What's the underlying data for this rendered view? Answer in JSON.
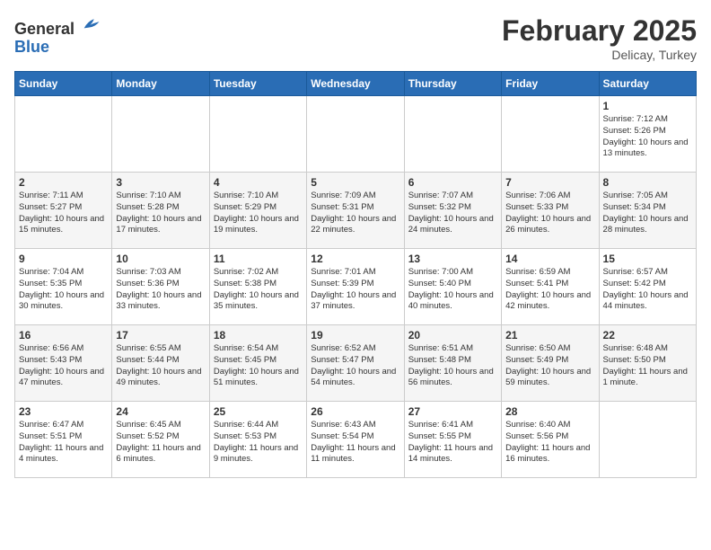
{
  "header": {
    "logo_general": "General",
    "logo_blue": "Blue",
    "month": "February 2025",
    "location": "Delicay, Turkey"
  },
  "weekdays": [
    "Sunday",
    "Monday",
    "Tuesday",
    "Wednesday",
    "Thursday",
    "Friday",
    "Saturday"
  ],
  "weeks": [
    [
      null,
      null,
      null,
      null,
      null,
      null,
      {
        "day": 1,
        "sunrise": "7:12 AM",
        "sunset": "5:26 PM",
        "daylight": "10 hours and 13 minutes."
      }
    ],
    [
      {
        "day": 2,
        "sunrise": "7:11 AM",
        "sunset": "5:27 PM",
        "daylight": "10 hours and 15 minutes."
      },
      {
        "day": 3,
        "sunrise": "7:10 AM",
        "sunset": "5:28 PM",
        "daylight": "10 hours and 17 minutes."
      },
      {
        "day": 4,
        "sunrise": "7:10 AM",
        "sunset": "5:29 PM",
        "daylight": "10 hours and 19 minutes."
      },
      {
        "day": 5,
        "sunrise": "7:09 AM",
        "sunset": "5:31 PM",
        "daylight": "10 hours and 22 minutes."
      },
      {
        "day": 6,
        "sunrise": "7:07 AM",
        "sunset": "5:32 PM",
        "daylight": "10 hours and 24 minutes."
      },
      {
        "day": 7,
        "sunrise": "7:06 AM",
        "sunset": "5:33 PM",
        "daylight": "10 hours and 26 minutes."
      },
      {
        "day": 8,
        "sunrise": "7:05 AM",
        "sunset": "5:34 PM",
        "daylight": "10 hours and 28 minutes."
      }
    ],
    [
      {
        "day": 9,
        "sunrise": "7:04 AM",
        "sunset": "5:35 PM",
        "daylight": "10 hours and 30 minutes."
      },
      {
        "day": 10,
        "sunrise": "7:03 AM",
        "sunset": "5:36 PM",
        "daylight": "10 hours and 33 minutes."
      },
      {
        "day": 11,
        "sunrise": "7:02 AM",
        "sunset": "5:38 PM",
        "daylight": "10 hours and 35 minutes."
      },
      {
        "day": 12,
        "sunrise": "7:01 AM",
        "sunset": "5:39 PM",
        "daylight": "10 hours and 37 minutes."
      },
      {
        "day": 13,
        "sunrise": "7:00 AM",
        "sunset": "5:40 PM",
        "daylight": "10 hours and 40 minutes."
      },
      {
        "day": 14,
        "sunrise": "6:59 AM",
        "sunset": "5:41 PM",
        "daylight": "10 hours and 42 minutes."
      },
      {
        "day": 15,
        "sunrise": "6:57 AM",
        "sunset": "5:42 PM",
        "daylight": "10 hours and 44 minutes."
      }
    ],
    [
      {
        "day": 16,
        "sunrise": "6:56 AM",
        "sunset": "5:43 PM",
        "daylight": "10 hours and 47 minutes."
      },
      {
        "day": 17,
        "sunrise": "6:55 AM",
        "sunset": "5:44 PM",
        "daylight": "10 hours and 49 minutes."
      },
      {
        "day": 18,
        "sunrise": "6:54 AM",
        "sunset": "5:45 PM",
        "daylight": "10 hours and 51 minutes."
      },
      {
        "day": 19,
        "sunrise": "6:52 AM",
        "sunset": "5:47 PM",
        "daylight": "10 hours and 54 minutes."
      },
      {
        "day": 20,
        "sunrise": "6:51 AM",
        "sunset": "5:48 PM",
        "daylight": "10 hours and 56 minutes."
      },
      {
        "day": 21,
        "sunrise": "6:50 AM",
        "sunset": "5:49 PM",
        "daylight": "10 hours and 59 minutes."
      },
      {
        "day": 22,
        "sunrise": "6:48 AM",
        "sunset": "5:50 PM",
        "daylight": "11 hours and 1 minute."
      }
    ],
    [
      {
        "day": 23,
        "sunrise": "6:47 AM",
        "sunset": "5:51 PM",
        "daylight": "11 hours and 4 minutes."
      },
      {
        "day": 24,
        "sunrise": "6:45 AM",
        "sunset": "5:52 PM",
        "daylight": "11 hours and 6 minutes."
      },
      {
        "day": 25,
        "sunrise": "6:44 AM",
        "sunset": "5:53 PM",
        "daylight": "11 hours and 9 minutes."
      },
      {
        "day": 26,
        "sunrise": "6:43 AM",
        "sunset": "5:54 PM",
        "daylight": "11 hours and 11 minutes."
      },
      {
        "day": 27,
        "sunrise": "6:41 AM",
        "sunset": "5:55 PM",
        "daylight": "11 hours and 14 minutes."
      },
      {
        "day": 28,
        "sunrise": "6:40 AM",
        "sunset": "5:56 PM",
        "daylight": "11 hours and 16 minutes."
      },
      null
    ]
  ]
}
